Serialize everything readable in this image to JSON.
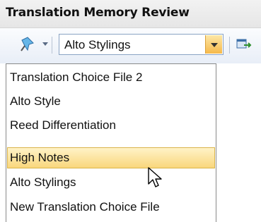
{
  "panel": {
    "title": "Translation Memory Review"
  },
  "toolbar": {
    "left_icon": "pin-icon",
    "right_icon": "export-icon",
    "combo_value": "Alto Stylings"
  },
  "menu": {
    "items": [
      {
        "label": "Translation Choice File 2",
        "state": "normal"
      },
      {
        "label": "Alto Style",
        "state": "normal"
      },
      {
        "label": "Reed Differentiation",
        "state": "normal"
      },
      {
        "label": "High Notes",
        "state": "hover"
      },
      {
        "label": "Alto Stylings",
        "state": "normal"
      },
      {
        "label": "New Translation Choice File",
        "state": "normal"
      }
    ]
  },
  "colors": {
    "hover_highlight": "#f9d77c",
    "toolbar_bg": "#e8eef7",
    "combo_border": "#8aa3c4"
  }
}
